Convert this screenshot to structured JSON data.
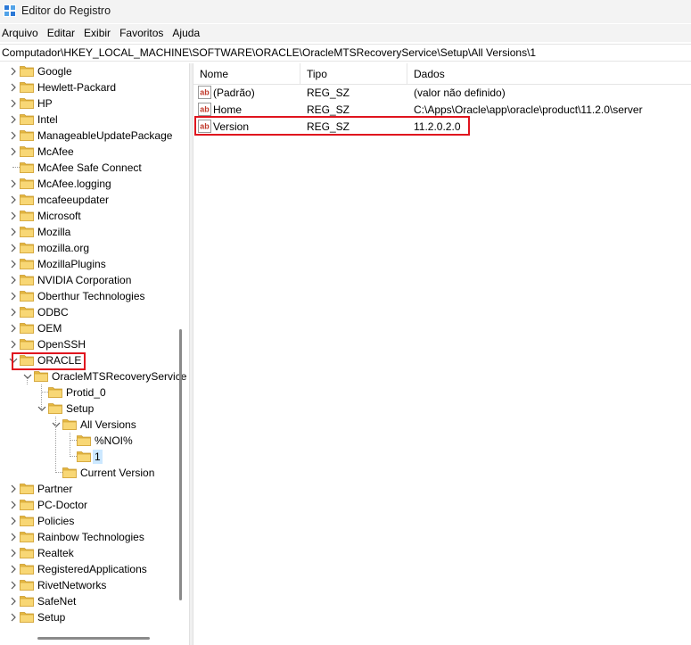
{
  "window": {
    "title": "Editor do Registro",
    "accent": "#2b78d6"
  },
  "menu": [
    "Arquivo",
    "Editar",
    "Exibir",
    "Favoritos",
    "Ajuda"
  ],
  "address": "Computador\\HKEY_LOCAL_MACHINE\\SOFTWARE\\ORACLE\\OracleMTSRecoveryService\\Setup\\All Versions\\1",
  "tree": {
    "items": [
      {
        "label": "Google",
        "arrow": "right"
      },
      {
        "label": "Hewlett-Packard",
        "arrow": "right"
      },
      {
        "label": "HP",
        "arrow": "right"
      },
      {
        "label": "Intel",
        "arrow": "right"
      },
      {
        "label": "ManageableUpdatePackage",
        "arrow": "right"
      },
      {
        "label": "McAfee",
        "arrow": "right"
      },
      {
        "label": "McAfee Safe Connect",
        "arrow": "none"
      },
      {
        "label": "McAfee.logging",
        "arrow": "right"
      },
      {
        "label": "mcafeeupdater",
        "arrow": "right"
      },
      {
        "label": "Microsoft",
        "arrow": "right"
      },
      {
        "label": "Mozilla",
        "arrow": "right"
      },
      {
        "label": "mozilla.org",
        "arrow": "right"
      },
      {
        "label": "MozillaPlugins",
        "arrow": "right"
      },
      {
        "label": "NVIDIA Corporation",
        "arrow": "right"
      },
      {
        "label": "Oberthur Technologies",
        "arrow": "right"
      },
      {
        "label": "ODBC",
        "arrow": "right"
      },
      {
        "label": "OEM",
        "arrow": "right"
      },
      {
        "label": "OpenSSH",
        "arrow": "right"
      },
      {
        "label": "ORACLE",
        "arrow": "down"
      },
      {
        "label": "OracleMTSRecoveryService",
        "arrow": "down"
      },
      {
        "label": "Protid_0",
        "arrow": "none"
      },
      {
        "label": "Setup",
        "arrow": "down"
      },
      {
        "label": "All Versions",
        "arrow": "down"
      },
      {
        "label": "%NOI%",
        "arrow": "none"
      },
      {
        "label": "1",
        "arrow": "none",
        "selected": true
      },
      {
        "label": "Current Version",
        "arrow": "none"
      },
      {
        "label": "Partner",
        "arrow": "right"
      },
      {
        "label": "PC-Doctor",
        "arrow": "right"
      },
      {
        "label": "Policies",
        "arrow": "right"
      },
      {
        "label": "Rainbow Technologies",
        "arrow": "right"
      },
      {
        "label": "Realtek",
        "arrow": "right"
      },
      {
        "label": "RegisteredApplications",
        "arrow": "right"
      },
      {
        "label": "RivetNetworks",
        "arrow": "right"
      },
      {
        "label": "SafeNet",
        "arrow": "right"
      },
      {
        "label": "Setup",
        "arrow": "right"
      }
    ],
    "folder_color": "#f8d775",
    "selection_color": "#cce8ff"
  },
  "list": {
    "columns": [
      "Nome",
      "Tipo",
      "Dados"
    ],
    "rows": [
      {
        "name": "(Padrão)",
        "type": "REG_SZ",
        "data": "(valor não definido)"
      },
      {
        "name": "Home",
        "type": "REG_SZ",
        "data": "C:\\Apps\\Oracle\\app\\oracle\\product\\11.2.0\\server"
      },
      {
        "name": "Version",
        "type": "REG_SZ",
        "data": "11.2.0.2.0"
      }
    ],
    "value_icon_text": "ab"
  },
  "highlight_color": "#e0141e"
}
